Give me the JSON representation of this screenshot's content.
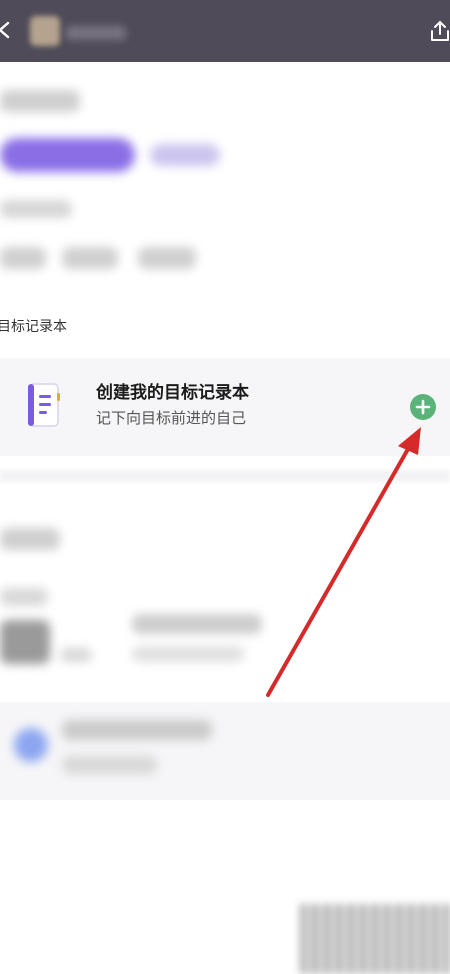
{
  "section": {
    "label": "目标记录本"
  },
  "create_card": {
    "title": "创建我的目标记录本",
    "subtitle": "记下向目标前进的自己"
  },
  "icons": {
    "back": "chevron-left-icon",
    "share": "share-icon",
    "notebook": "notebook-icon",
    "add": "plus-circle-icon"
  },
  "colors": {
    "topbar": "#4f4b58",
    "accent_purple": "#7a5ce0",
    "add_green": "#5bb37a",
    "arrow_red": "#d42a2a"
  }
}
